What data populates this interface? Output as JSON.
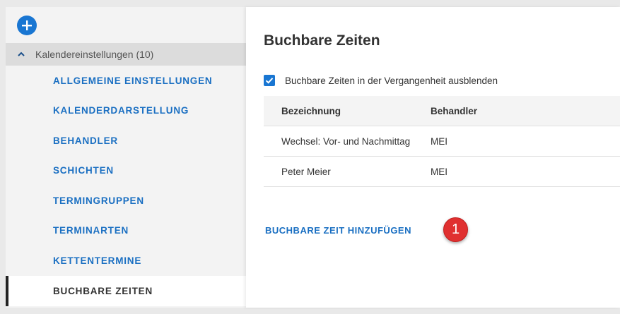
{
  "sidebar": {
    "add_icon": "plus-icon",
    "group_label": "Kalendereinstellungen (10)",
    "items": [
      {
        "label": "ALLGEMEINE EINSTELLUNGEN"
      },
      {
        "label": "KALENDERDARSTELLUNG"
      },
      {
        "label": "BEHANDLER"
      },
      {
        "label": "SCHICHTEN"
      },
      {
        "label": "TERMINGRUPPEN"
      },
      {
        "label": "TERMINARTEN"
      },
      {
        "label": "KETTENTERMINE"
      },
      {
        "label": "BUCHBARE ZEITEN",
        "active": true
      }
    ]
  },
  "panel": {
    "title": "Buchbare Zeiten",
    "checkbox_label": "Buchbare Zeiten in der Vergangenheit ausblenden",
    "checkbox_checked": true,
    "table": {
      "headers": [
        "Bezeichnung",
        "Behandler"
      ],
      "rows": [
        [
          "Wechsel: Vor- und Nachmittag",
          "MEI"
        ],
        [
          "Peter Meier",
          "MEI"
        ]
      ]
    },
    "add_label": "BUCHBARE ZEIT HINZUFÜGEN",
    "badge": "1"
  },
  "colors": {
    "accent": "#1976d2",
    "link": "#1a6fc2",
    "badge": "#e03030"
  }
}
